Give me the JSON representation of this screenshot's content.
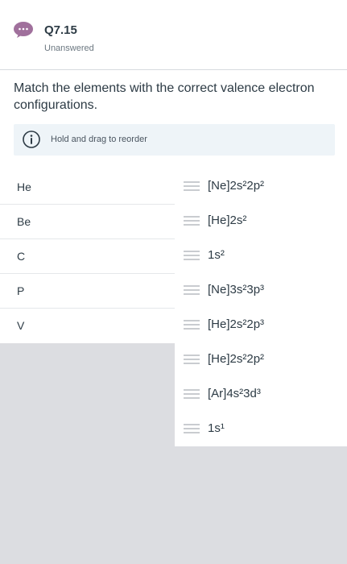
{
  "header": {
    "question_number": "Q7.15",
    "status": "Unanswered"
  },
  "prompt": "Match the elements with the correct valence electron configurations.",
  "hint": "Hold and drag to reorder",
  "elements": [
    "He",
    "Be",
    "C",
    "P",
    "V"
  ],
  "configurations": [
    "[Ne]2s²2p²",
    "[He]2s²",
    "1s²",
    "[Ne]3s²3p³",
    "[He]2s²2p³",
    "[He]2s²2p²",
    "[Ar]4s²3d³",
    "1s¹"
  ],
  "colors": {
    "chat_icon": "#a0709c",
    "hint_background": "#eef4f8",
    "unused_area": "#dcdde1"
  }
}
